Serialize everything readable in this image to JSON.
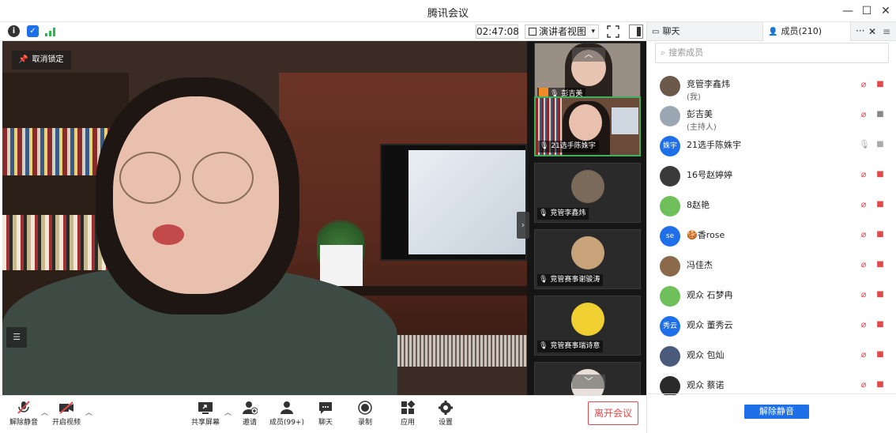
{
  "window": {
    "title": "腾讯会议",
    "minimize": "—",
    "maximize": "☐",
    "close": "✕"
  },
  "toolbar": {
    "timer": "02:47:08",
    "view_label": "演讲者视图",
    "view_caret": "▾"
  },
  "main_video": {
    "unlock_label": "取消锁定"
  },
  "thumbnails": [
    {
      "name": "彭吉美",
      "active": false
    },
    {
      "name": "21选手陈姝宇",
      "active": true
    },
    {
      "name": "竞管李鑫炜",
      "active": false
    },
    {
      "name": "竞管赛事谢骏涛",
      "active": false
    },
    {
      "name": "竞管赛事瑞诗意",
      "active": false
    }
  ],
  "bottom": {
    "unmute": "解除静音",
    "start_video": "开启视频",
    "share_screen": "共享屏幕",
    "invite": "邀请",
    "members": "成员(99+)",
    "chat": "聊天",
    "record": "录制",
    "apps": "应用",
    "settings": "设置",
    "leave": "离开会议"
  },
  "panel": {
    "tab_chat": "聊天",
    "tab_members": "成员(210)",
    "more": "···",
    "close": "✕",
    "menu": "≡",
    "search_placeholder": "搜索成员",
    "unmute_all": "解除静音",
    "members": [
      {
        "name": "竞管李鑫炜",
        "sub": "(我)",
        "avatar_text": "",
        "avatar_color": "#6b5a4a"
      },
      {
        "name": "彭吉美",
        "sub": "(主持人)",
        "avatar_text": "",
        "avatar_color": "#9aa6b2"
      },
      {
        "name": "21选手陈姝宇",
        "sub": "",
        "avatar_text": "姝宇",
        "avatar_color": "#1e6fe8"
      },
      {
        "name": "16号赵婷婷",
        "sub": "",
        "avatar_text": "",
        "avatar_color": "#3a3a3a"
      },
      {
        "name": "8赵艳",
        "sub": "",
        "avatar_text": "",
        "avatar_color": "#6fbf5a"
      },
      {
        "name": "🍪香rose",
        "sub": "",
        "avatar_text": "se",
        "avatar_color": "#1e6fe8"
      },
      {
        "name": "冯佳杰",
        "sub": "",
        "avatar_text": "",
        "avatar_color": "#8a6a4a"
      },
      {
        "name": "观众  石梦冉",
        "sub": "",
        "avatar_text": "",
        "avatar_color": "#6fbf5a"
      },
      {
        "name": "观众 董秀云",
        "sub": "",
        "avatar_text": "秀云",
        "avatar_color": "#1e6fe8"
      },
      {
        "name": "观众 包灿",
        "sub": "",
        "avatar_text": "",
        "avatar_color": "#4a5a7a"
      },
      {
        "name": "观众 蔡诺",
        "sub": "",
        "avatar_text": "",
        "avatar_color": "#2a2a2a"
      }
    ]
  }
}
